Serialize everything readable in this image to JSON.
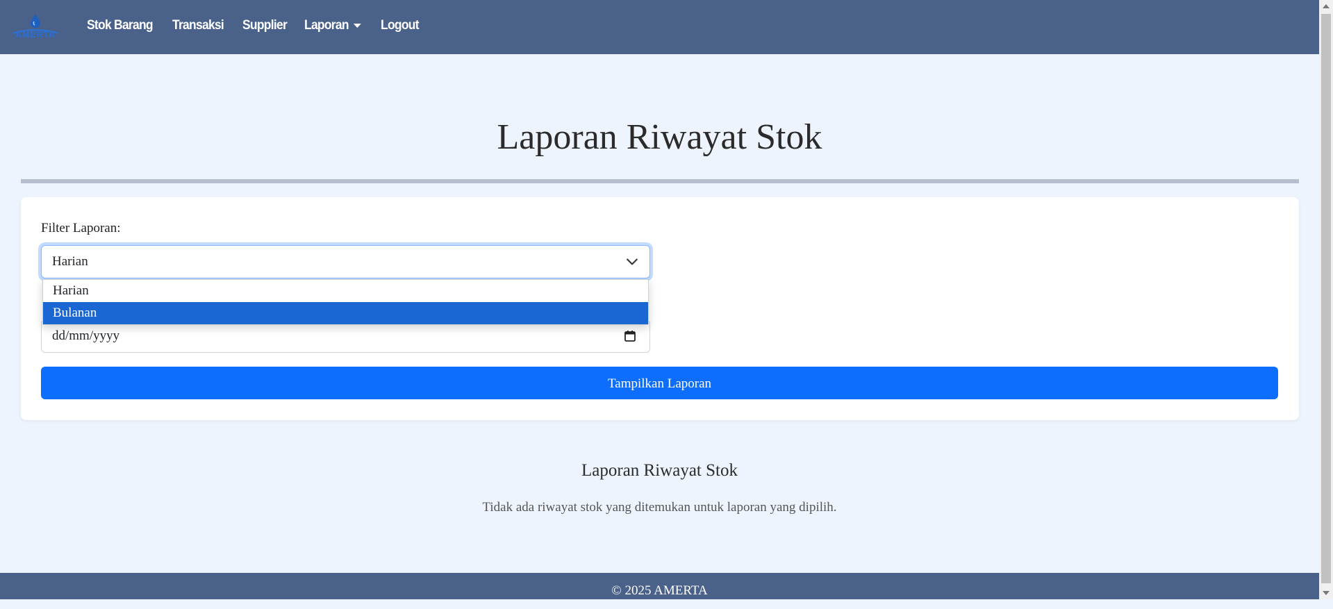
{
  "navbar": {
    "logo_text": "AMERTA",
    "items": [
      {
        "label": "Stok Barang"
      },
      {
        "label": "Transaksi"
      },
      {
        "label": "Supplier"
      },
      {
        "label": "Laporan",
        "has_dropdown": true
      },
      {
        "label": "Logout"
      }
    ]
  },
  "page": {
    "title": "Laporan Riwayat Stok"
  },
  "filter": {
    "label": "Filter Laporan:",
    "selected": "Harian",
    "options": [
      "Harian",
      "Bulanan"
    ],
    "highlighted_option": "Bulanan",
    "date_placeholder": "dd/mm/yyyy",
    "submit_label": "Tampilkan Laporan"
  },
  "results": {
    "title": "Laporan Riwayat Stok",
    "empty_message": "Tidak ada riwayat stok yang ditemukan untuk laporan yang dipilih."
  },
  "footer": {
    "text": "© 2025 AMERTA"
  },
  "colors": {
    "navbar_bg": "#4a6189",
    "page_bg": "#eef4fd",
    "primary": "#0d6efd",
    "option_highlight": "#1a66d2"
  }
}
